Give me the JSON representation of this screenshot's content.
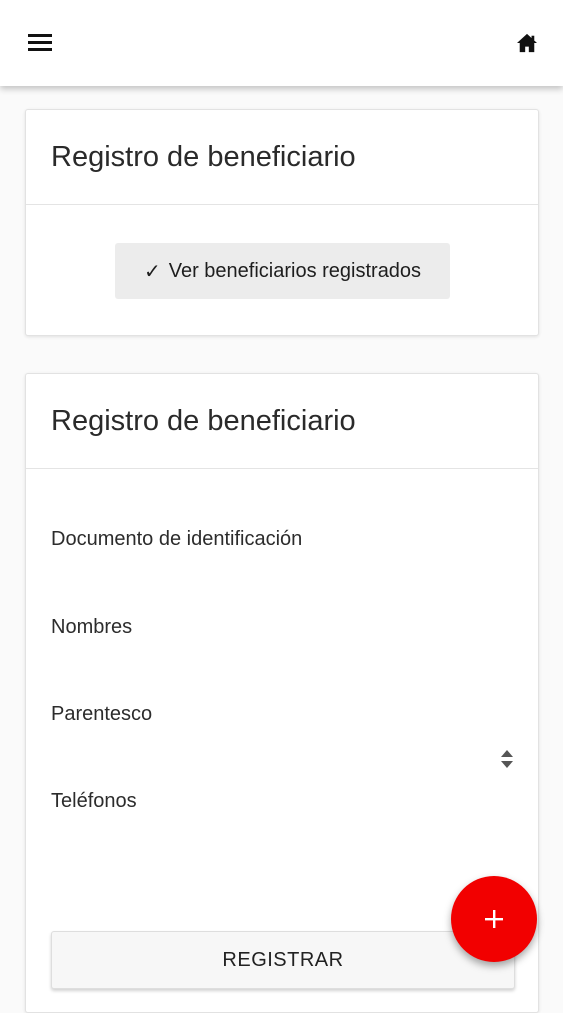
{
  "topbar": {
    "menu_icon": "hamburger-menu-icon",
    "home_icon": "home-icon"
  },
  "card_list": {
    "title": "Registro de beneficiario",
    "view_button": {
      "check_glyph": "✓",
      "label": "Ver beneficiarios registrados"
    }
  },
  "card_form": {
    "title": "Registro de beneficiario",
    "fields": [
      {
        "label": "Documento de identificación",
        "value": ""
      },
      {
        "label": "Nombres",
        "value": ""
      },
      {
        "label": "Parentesco",
        "value": ""
      },
      {
        "label": "Teléfonos",
        "value": ""
      }
    ],
    "submit_label": "REGISTRAR"
  },
  "fab": {
    "icon": "plus-icon",
    "color": "#f20000"
  }
}
